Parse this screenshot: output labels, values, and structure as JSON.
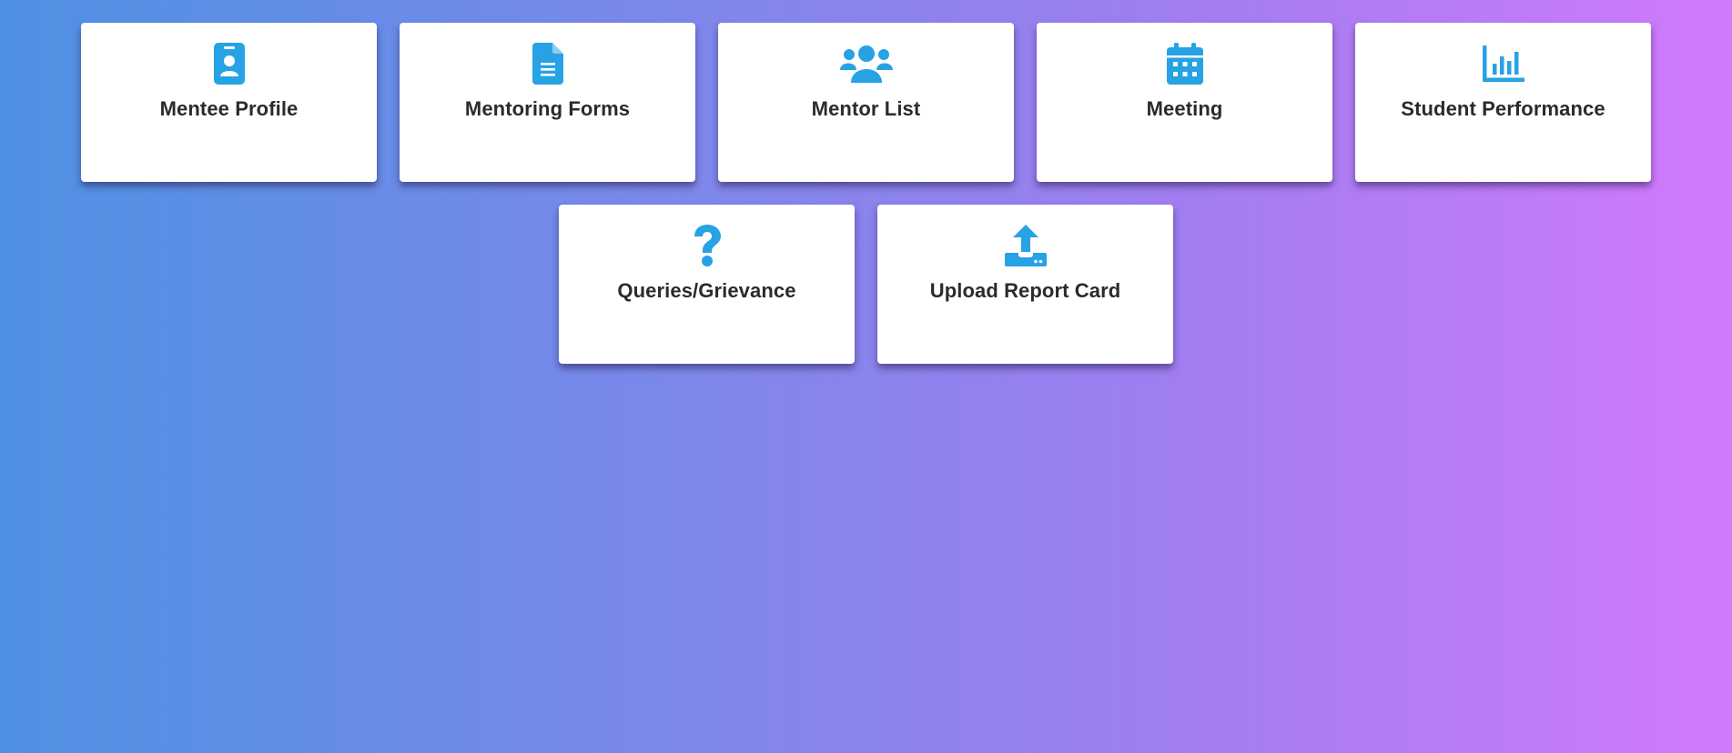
{
  "colors": {
    "icon": "#27a2e4",
    "label": "#2b2b2b",
    "card_bg": "#ffffff",
    "gradient_start": "#4e91e4",
    "gradient_end": "#d17afb"
  },
  "cards": [
    {
      "label": "Mentee Profile",
      "icon": "id-badge-icon"
    },
    {
      "label": "Mentoring Forms",
      "icon": "file-text-icon"
    },
    {
      "label": "Mentor List",
      "icon": "users-icon"
    },
    {
      "label": "Meeting",
      "icon": "calendar-icon"
    },
    {
      "label": "Student Performance",
      "icon": "bar-chart-icon"
    },
    {
      "label": "Queries/Grievance",
      "icon": "question-icon"
    },
    {
      "label": "Upload Report Card",
      "icon": "upload-icon"
    }
  ]
}
